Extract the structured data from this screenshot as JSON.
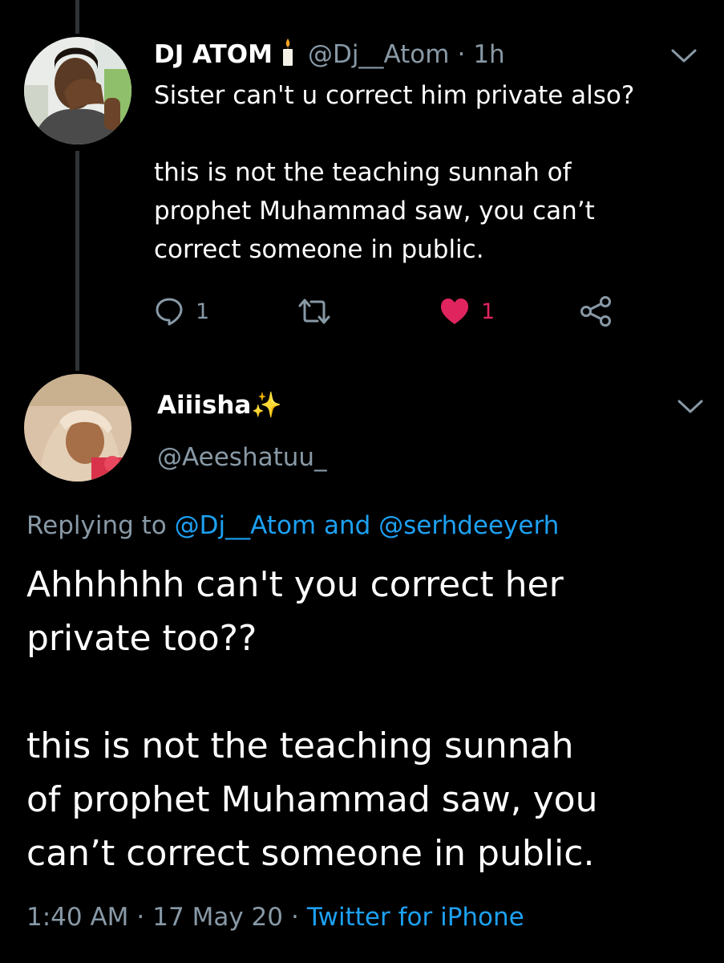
{
  "tweet1": {
    "display_name": "DJ ATOM",
    "name_emoji": "candle-emoji",
    "handle": "@Dj__Atom",
    "time": "1h",
    "body": [
      "Sister can't u correct him private also?",
      "",
      "this is not the teaching sunnah of",
      "prophet Muhammad saw, you can’t",
      "correct someone in public."
    ],
    "actions": {
      "reply_count": "1",
      "retweet_count": "",
      "like_count": "1",
      "liked": true
    }
  },
  "tweet2": {
    "display_name": "Aiiisha✨",
    "handle": "@Aeeshatuu_",
    "replying_prefix": "Replying to",
    "replying_handle_1": "@Dj__Atom",
    "replying_and": "and",
    "replying_handle_2": "@serhdeeyerh",
    "body": [
      "Ahhhhhh can't you correct her",
      "private too??",
      "",
      "this is not the teaching sunnah",
      "of prophet Muhammad saw, you",
      "can’t correct someone in public."
    ],
    "time": "1:40 AM",
    "date": "17 May 20",
    "source": "Twitter for iPhone"
  },
  "colors": {
    "background": "#000000",
    "muted_text": "#8899a6",
    "link": "#1da1f2",
    "like": "#e0245e",
    "thread_line": "#2f3336"
  }
}
